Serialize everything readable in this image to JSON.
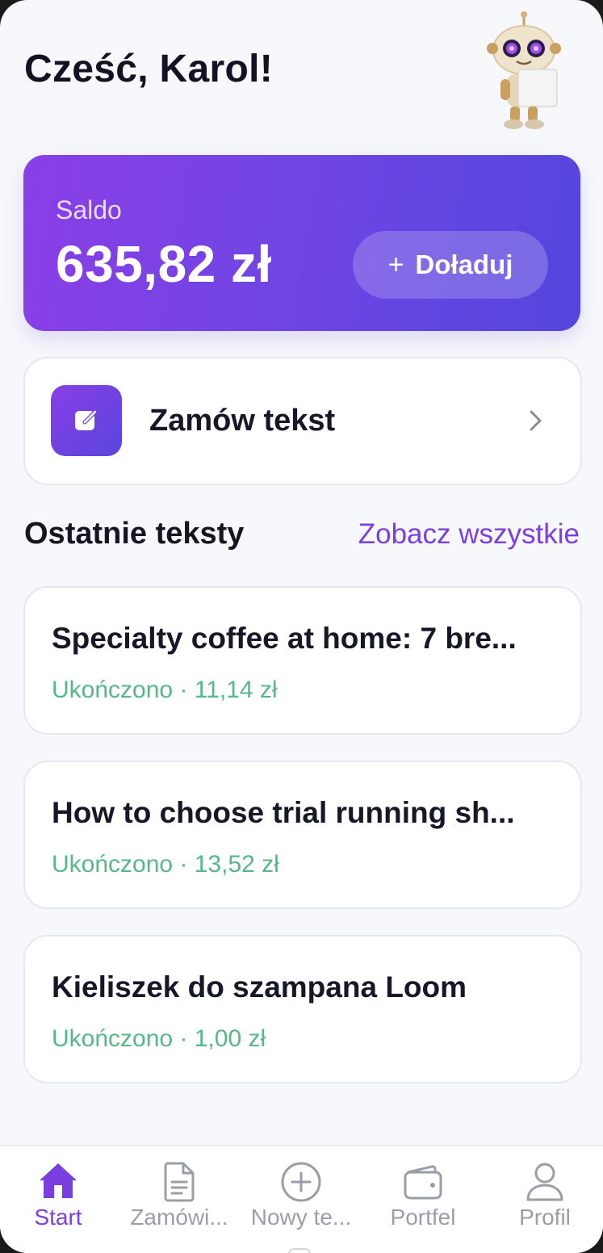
{
  "header": {
    "greeting": "Cześć, Karol!",
    "mascot_icon": "robot-mascot-icon"
  },
  "balance": {
    "label": "Saldo",
    "amount": "635,82 zł",
    "topup_icon": "plus-icon",
    "topup_label": "Doładuj"
  },
  "order": {
    "icon": "edit-icon",
    "label": "Zamów tekst",
    "chevron_icon": "chevron-right-icon"
  },
  "recent": {
    "title": "Ostatnie teksty",
    "see_all": "Zobacz wszystkie",
    "items": [
      {
        "title": "Specialty coffee at home: 7 bre...",
        "meta": "Ukończono · 11,14 zł"
      },
      {
        "title": "How to choose trial running sh...",
        "meta": "Ukończono · 13,52 zł"
      },
      {
        "title": "Kieliszek do szampana Loom",
        "meta": "Ukończono · 1,00 zł"
      }
    ]
  },
  "tabs": [
    {
      "label": "Start",
      "icon": "home-icon",
      "active": true
    },
    {
      "label": "Zamówi...",
      "icon": "document-icon",
      "active": false
    },
    {
      "label": "Nowy te...",
      "icon": "plus-circle-icon",
      "active": false
    },
    {
      "label": "Portfel",
      "icon": "wallet-icon",
      "active": false
    },
    {
      "label": "Profil",
      "icon": "user-icon",
      "active": false
    }
  ],
  "colors": {
    "accent": "#7b3fe0",
    "gradient_start": "#8a3ee6",
    "gradient_end": "#5346dd",
    "status_done": "#55b887",
    "background": "#f7f8fb"
  }
}
